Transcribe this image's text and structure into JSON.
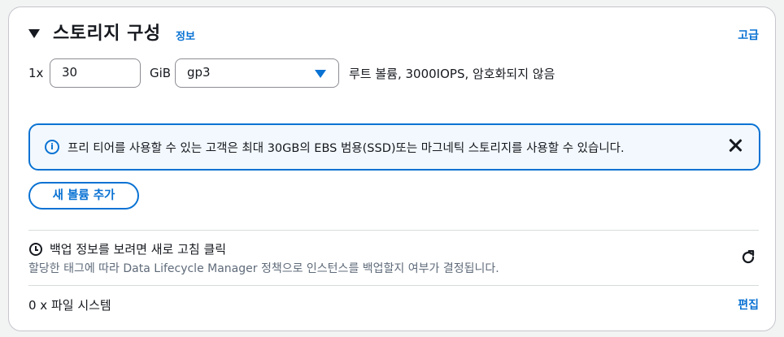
{
  "header": {
    "title": "스토리지 구성",
    "info_link": "정보",
    "advanced_link": "고급"
  },
  "volume": {
    "count": "1x",
    "size_value": "30",
    "size_unit": "GiB",
    "volume_type": "gp3",
    "description": "루트 볼륨,  3000IOPS,  암호화되지 않음"
  },
  "alert": {
    "icon": "info-icon",
    "message": "프리 티어를 사용할 수 있는 고객은 최대 30GB의 EBS 범용(SSD)또는 마그네틱 스토리지를 사용할 수 있습니다."
  },
  "add_volume_button": "새 볼륨 추가",
  "backup": {
    "title": "백업 정보를 보려면 새로 고침 클릭",
    "description": "할당한 태그에 따라 Data Lifecycle Manager 정책으로 인스턴스를 백업할지 여부가 결정됩니다."
  },
  "file_systems": {
    "count_label": "0 x 파일 시스템",
    "edit_link": "편집"
  },
  "colors": {
    "accent": "#0972d3",
    "alert_bg": "#f2f8fd",
    "text": "#16191f",
    "secondary_text": "#5f6b7a"
  }
}
